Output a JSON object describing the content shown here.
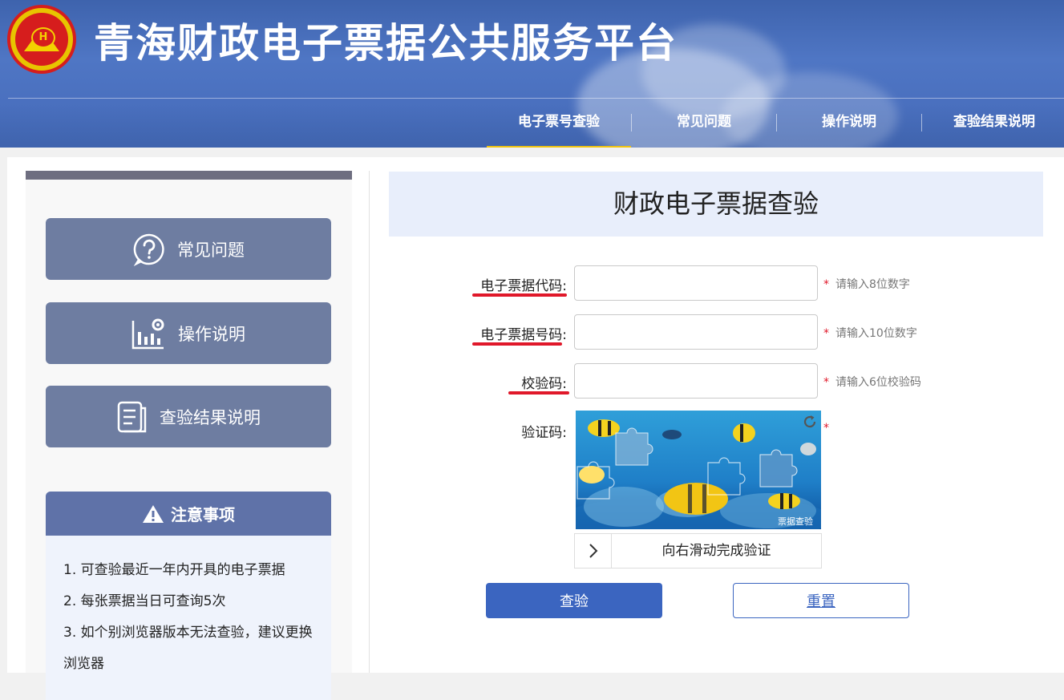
{
  "site": {
    "title": "青海财政电子票据公共服务平台",
    "logo_text": "H"
  },
  "nav": {
    "items": [
      {
        "label": "电子票号查验",
        "active": true
      },
      {
        "label": "常见问题",
        "active": false
      },
      {
        "label": "操作说明",
        "active": false
      },
      {
        "label": "查验结果说明",
        "active": false
      }
    ]
  },
  "sidebar": {
    "buttons": [
      {
        "label": "常见问题",
        "icon": "question-icon"
      },
      {
        "label": "操作说明",
        "icon": "chart-gear-icon"
      },
      {
        "label": "查验结果说明",
        "icon": "document-icon"
      }
    ],
    "notice": {
      "title": "注意事项",
      "items": [
        "1. 可查验最近一年内开具的电子票据",
        "2. 每张票据当日可查询5次",
        "3. 如个别浏览器版本无法查验，建议更换浏览器"
      ]
    }
  },
  "form": {
    "title": "财政电子票据查验",
    "fields": [
      {
        "label": "电子票据代码:",
        "value": "",
        "hint": "请输入8位数字"
      },
      {
        "label": "电子票据号码:",
        "value": "",
        "hint": "请输入10位数字"
      },
      {
        "label": "校验码:",
        "value": "",
        "hint": "请输入6位校验码"
      }
    ],
    "captcha": {
      "label": "验证码:",
      "watermark": "票据查验",
      "slider_text": "向右滑动完成验证"
    },
    "required_mark": "*",
    "submit_label": "查验",
    "reset_label": "重置"
  },
  "colors": {
    "header_bg": "#4a70bf",
    "accent_yellow": "#f1c40f",
    "primary": "#3b65c0",
    "required_red": "#e0182a",
    "sidebar_button": "#6e7da1"
  }
}
